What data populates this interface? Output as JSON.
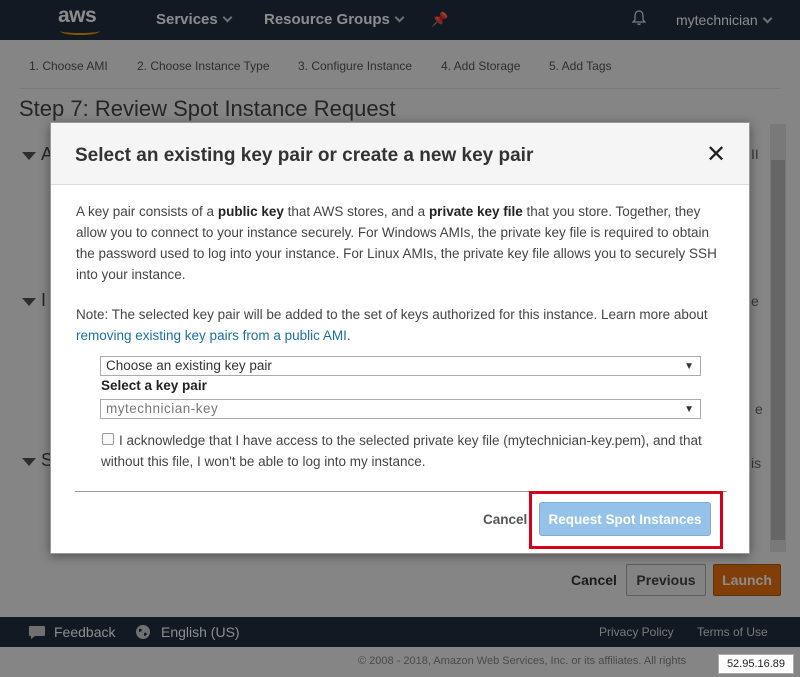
{
  "nav": {
    "logo": "aws",
    "services": "Services",
    "resource_groups": "Resource Groups",
    "user": "mytechnician"
  },
  "wizard": {
    "steps": [
      "1. Choose AMI",
      "2. Choose Instance Type",
      "3. Configure Instance",
      "4. Add Storage",
      "5. Add Tags"
    ]
  },
  "page": {
    "title": "Step 7: Review Spot Instance Request",
    "section_letters": [
      "A",
      "I",
      "S"
    ],
    "edge_texts": [
      "II",
      "e",
      "e",
      "is"
    ],
    "cancel": "Cancel",
    "previous": "Previous",
    "launch": "Launch"
  },
  "footer": {
    "feedback": "Feedback",
    "language": "English (US)",
    "privacy": "Privacy Policy",
    "terms": "Terms of Use",
    "copyright": "© 2008 - 2018, Amazon Web Services, Inc. or its affiliates. All rights",
    "ip": "52.95.16.89"
  },
  "modal": {
    "title": "Select an existing key pair or create a new key pair",
    "close": "✕",
    "intro": {
      "p1": "A key pair consists of a ",
      "b1": "public key",
      "p2": " that AWS stores, and a ",
      "b2": "private key file",
      "p3": " that you store. Together, they allow you to connect to your instance securely. For Windows AMIs, the private key file is required to obtain the password used to log into your instance. For Linux AMIs, the private key file allows you to securely SSH into your instance."
    },
    "note": {
      "text": "Note: The selected key pair will be added to the set of keys authorized for this instance. Learn more about ",
      "link": "removing existing key pairs from a public AMI",
      "end": "."
    },
    "key_option_select": "Choose an existing key pair",
    "select_label": "Select a key pair",
    "key_pair_select": "mytechnician-key",
    "acknowledge": "I acknowledge that I have access to the selected private key file (mytechnician-key.pem), and that without this file, I won't be able to log into my instance.",
    "cancel": "Cancel",
    "request": "Request Spot Instances"
  }
}
